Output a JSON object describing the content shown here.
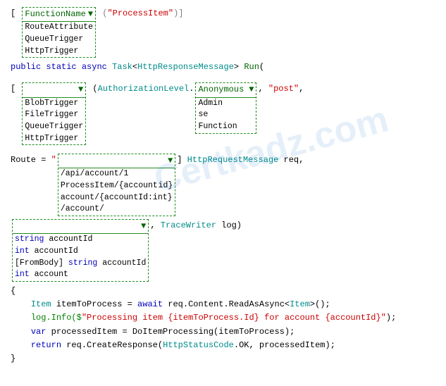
{
  "watermark": "Certkadz.com",
  "sections": {
    "line1": "[ ",
    "line1_comment": "(\"ProcessItem\")]",
    "dd1": {
      "header": "FunctionName",
      "items": [
        "RouteAttribute",
        "QueueTrigger",
        "HttpTrigger"
      ]
    },
    "line2": "public static async Task<HttpResponseMessage> Run(",
    "line3_prefix": "[ ",
    "line3_comment": "(AuthorizationLevel.",
    "line3_suffix": ", \"post\",",
    "dd2": {
      "header": "",
      "items": [
        "BlobTrigger",
        "FileTrigger",
        "QueueTrigger",
        "HttpTrigger"
      ]
    },
    "dd3": {
      "header": "Anonymous",
      "items": [
        "Admin",
        "se",
        "Function"
      ]
    },
    "line4_prefix": "Route = \"",
    "line4_suffix": "] HttpRequestMessage req,",
    "dd4": {
      "header": "",
      "items": [
        "/api/account/1",
        "ProcessItem/{account id}",
        "account/{accountId:int}",
        "/account/"
      ]
    },
    "dd5": {
      "header": "",
      "items": [
        "string accountId",
        "int accountId",
        "[FromBody] string accountId",
        "int account"
      ]
    },
    "line5_suffix": ", TraceWriter log)",
    "body": [
      "{",
      "    Item itemToProcess = await req.Content.ReadAsAsync<Item>();",
      "    log.Info($\"Processing item {itemToProcess.Id} for account {accountId}\");",
      "    var processedItem = DoItemProcessing(itemToProcess);",
      "    return req.CreateResponse(HttpStatusCode.OK, processedItem);",
      "}"
    ]
  }
}
